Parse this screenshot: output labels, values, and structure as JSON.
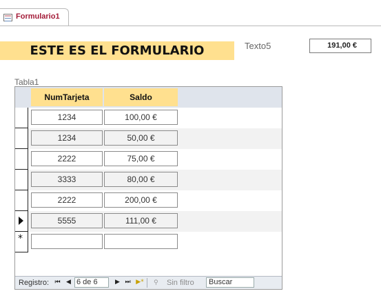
{
  "tab": {
    "label": "Formulario1",
    "icon": "form-icon"
  },
  "form": {
    "title": "ESTE ES EL FORMULARIO",
    "texto5_label": "Texto5",
    "texto5_value": "191,00 €",
    "subform_label": "Tabla1"
  },
  "table": {
    "columns": [
      "NumTarjeta",
      "Saldo"
    ],
    "rows": [
      {
        "num": "1234",
        "saldo": "100,00 €"
      },
      {
        "num": "1234",
        "saldo": "50,00 €"
      },
      {
        "num": "2222",
        "saldo": "75,00 €"
      },
      {
        "num": "3333",
        "saldo": "80,00 €"
      },
      {
        "num": "2222",
        "saldo": "200,00 €"
      },
      {
        "num": "5555",
        "saldo": "111,00 €"
      }
    ],
    "current_row_index": 5
  },
  "navigation": {
    "label": "Registro:",
    "position": "6 de 6",
    "filter_label": "Sin filtro",
    "search_text": "Buscar",
    "buttons": {
      "first": "⏮",
      "prev": "◀",
      "next": "▶",
      "last": "⏭",
      "new": "▶*"
    }
  },
  "colors": {
    "header_band": "#ffe08f",
    "tab_label": "#a31a37"
  }
}
